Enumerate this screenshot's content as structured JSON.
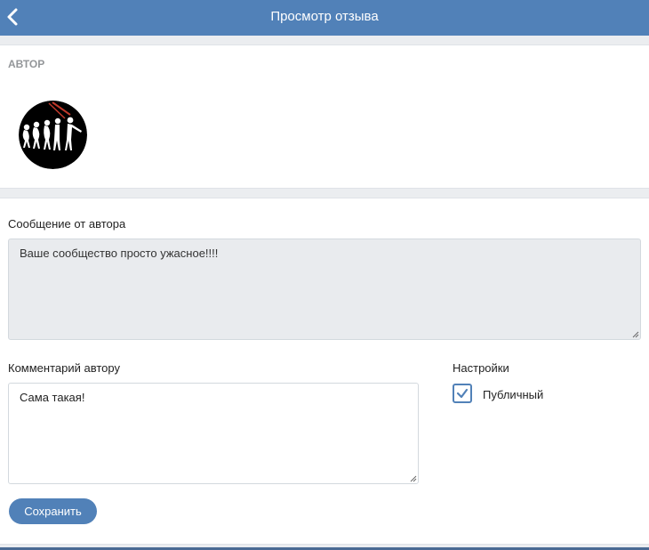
{
  "header": {
    "title": "Просмотр отзыва",
    "back_icon": "chevron-left-icon"
  },
  "author": {
    "section_label": "АВТОР",
    "avatar_icon": "evolution-avatar"
  },
  "message": {
    "label": "Сообщение от автора",
    "text": "Ваше сообщество просто ужасное!!!!"
  },
  "comment": {
    "label": "Комментарий автору",
    "value": "Сама такая!"
  },
  "settings": {
    "label": "Настройки",
    "public_label": "Публичный",
    "public_checked": true
  },
  "actions": {
    "save_label": "Сохранить"
  },
  "colors": {
    "accent": "#5181b8",
    "page_bg": "#ebedf0",
    "readonly_bg": "#e9ebee"
  }
}
